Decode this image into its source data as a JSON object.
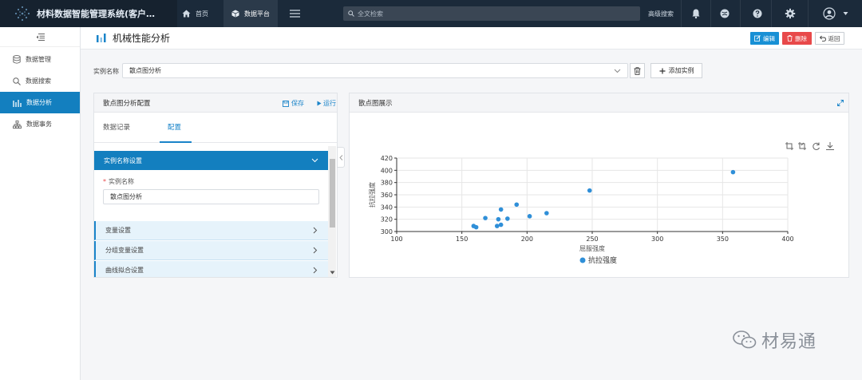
{
  "topbar": {
    "title": "材料数据智能管理系统(客户…",
    "nav": [
      {
        "label": "首页",
        "icon": "home-icon"
      },
      {
        "label": "数据平台",
        "icon": "cube-icon"
      }
    ],
    "search_placeholder": "全文检索",
    "advanced_search": "高级搜索",
    "icons": [
      "bell-icon",
      "globe-icon",
      "help-icon",
      "gear-icon",
      "user-avatar-icon",
      "caret-down-icon"
    ],
    "colors": {
      "bar": "#1b2a3a",
      "brand_bg": "#16222f",
      "active_nav": "#2b3a4a"
    }
  },
  "sidebar": {
    "items": [
      {
        "label": "数据管理",
        "icon": "database-icon"
      },
      {
        "label": "数据搜索",
        "icon": "search-icon"
      },
      {
        "label": "数据分析",
        "icon": "bar-chart-icon",
        "active": true
      },
      {
        "label": "数据事务",
        "icon": "org-tree-icon"
      }
    ],
    "accent": "#137fbf"
  },
  "page": {
    "title": "机械性能分析",
    "buttons": {
      "edit": "编辑",
      "delete": "删除",
      "back": "返回"
    }
  },
  "instance": {
    "label": "实例名称",
    "value": "散点图分析",
    "add_label": "添加实例"
  },
  "config_panel": {
    "title": "散点图分析配置",
    "save": "保存",
    "run": "运行",
    "tabs": [
      {
        "label": "数据记录",
        "active": false
      },
      {
        "label": "配置",
        "active": true
      }
    ],
    "open_section": "实例名称设置",
    "field_label": "实例名称",
    "field_value": "散点图分析",
    "sections": [
      "变量设置",
      "分组变量设置",
      "曲线拟合设置"
    ]
  },
  "chart_panel": {
    "title": "散点图展示",
    "toolbar_icons": [
      "zoom-select-icon",
      "zoom-reset-icon",
      "refresh-icon",
      "download-icon"
    ]
  },
  "chart_data": {
    "type": "scatter",
    "xlabel": "屈服强度",
    "ylabel": "抗拉强度",
    "xlim": [
      100,
      400
    ],
    "ylim": [
      300,
      420
    ],
    "xticks": [
      100,
      150,
      200,
      250,
      300,
      350,
      400
    ],
    "yticks": [
      300,
      320,
      340,
      360,
      380,
      400,
      420
    ],
    "grid": true,
    "legend_position": "bottom-center",
    "series": [
      {
        "name": "抗拉强度",
        "color": "#2f8fd8",
        "points": [
          [
            159,
            309
          ],
          [
            161,
            307
          ],
          [
            168,
            322
          ],
          [
            177,
            309
          ],
          [
            178,
            320
          ],
          [
            180,
            336
          ],
          [
            180,
            311
          ],
          [
            185,
            321
          ],
          [
            192,
            344
          ],
          [
            202,
            325
          ],
          [
            215,
            330
          ],
          [
            248,
            367
          ],
          [
            358,
            397
          ]
        ]
      }
    ]
  },
  "watermark": "材易通"
}
